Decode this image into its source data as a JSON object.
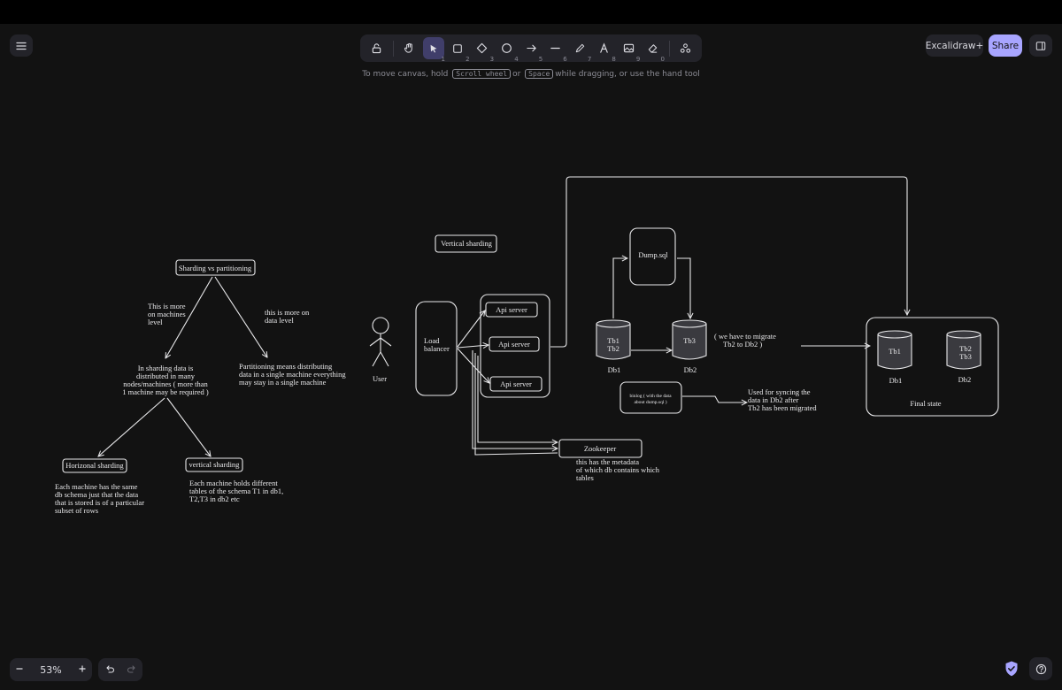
{
  "toolbar": {
    "tools": [
      {
        "name": "lock",
        "key": ""
      },
      {
        "name": "hand",
        "key": ""
      },
      {
        "name": "selection",
        "key": "1"
      },
      {
        "name": "rectangle",
        "key": "2"
      },
      {
        "name": "diamond",
        "key": "3"
      },
      {
        "name": "ellipse",
        "key": "4"
      },
      {
        "name": "arrow",
        "key": "5"
      },
      {
        "name": "line",
        "key": "6"
      },
      {
        "name": "draw",
        "key": "7"
      },
      {
        "name": "text",
        "key": "8"
      },
      {
        "name": "image",
        "key": "9"
      },
      {
        "name": "eraser",
        "key": "0"
      },
      {
        "name": "extra-tools",
        "key": ""
      }
    ]
  },
  "header": {
    "excalidraw_plus": "Excalidraw+",
    "share": "Share"
  },
  "hint": {
    "before": "To move canvas, hold",
    "key1": "Scroll wheel",
    "or": "or",
    "key2": "Space",
    "after": "while dragging, or use the hand tool"
  },
  "footer": {
    "zoom": "53%"
  },
  "drawing": {
    "sharding_title": "Sharding vs partitioning",
    "machines_note": [
      "This is more",
      "on machines",
      "level"
    ],
    "data_note": [
      "this is more on",
      "data level"
    ],
    "sharding_def": [
      "In sharding data is",
      "distributed in many",
      "nodes/machines ( more than",
      "1 machine may be required )"
    ],
    "partitioning_def": [
      "Partitioning means distributing",
      "data in a single machine everything",
      "may stay in a single machine"
    ],
    "horizontal_label": "Horizonal sharding",
    "vertical_label": "vertical sharding",
    "horizontal_def": [
      "Each machine has the same",
      "db schema just that the data",
      "that is stored is of a particular",
      "subset of rows"
    ],
    "vertical_def": [
      "Each machine holds different",
      "tables of the schema T1 in db1,",
      "T2,T3 in db2 etc"
    ],
    "vertical_title": "Vertical sharding",
    "user_label": "User",
    "lb_label": [
      "Load",
      "balancer"
    ],
    "api_servers": [
      "Api server",
      "Api server",
      "Api server"
    ],
    "dump_label": "Dump.sql",
    "db1_tables": [
      "Tb1",
      "Tb2"
    ],
    "db1_label": "Db1",
    "db2_tables": [
      "Tb3"
    ],
    "db2_label": "Db2",
    "migrate_note": [
      "( we have to migrate",
      "Tb2 to Db2 )"
    ],
    "binlog_note": [
      "binlog ( with the data",
      "about dump.sql )"
    ],
    "sync_note": [
      "Used for syncing the",
      "data in Db2 after",
      "Tb2 has been migrated"
    ],
    "zookeeper_label": "Zookeeper",
    "zookeeper_note": [
      "this has the metadata",
      "of which db contains which",
      "tables"
    ],
    "final_db1_tables": [
      "Tb1"
    ],
    "final_db1_label": "Db1",
    "final_db2_tables": [
      "Tb2",
      "Tb3"
    ],
    "final_db2_label": "Db2",
    "final_label": "Final state"
  }
}
